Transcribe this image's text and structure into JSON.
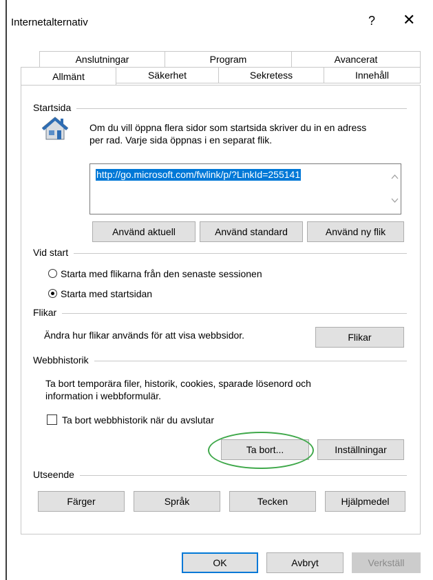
{
  "window": {
    "title": "Internetalternativ",
    "help_symbol": "?",
    "close_symbol": "✕"
  },
  "tabs_top": [
    "Anslutningar",
    "Program",
    "Avancerat"
  ],
  "tabs_bottom": [
    "Allmänt",
    "Säkerhet",
    "Sekretess",
    "Innehåll"
  ],
  "active_tab": "Allmänt",
  "startsida": {
    "title": "Startsida",
    "description_line1": "Om du vill öppna flera sidor som startsida skriver du in en adress",
    "description_line2": "per rad. Varje sida öppnas i en separat flik.",
    "url": "http://go.microsoft.com/fwlink/p/?LinkId=255141",
    "buttons": [
      "Använd aktuell",
      "Använd standard",
      "Använd ny flik"
    ]
  },
  "vid_start": {
    "title": "Vid start",
    "options": [
      "Starta med flikarna från den senaste sessionen",
      "Starta med startsidan"
    ],
    "selected_index": 1
  },
  "flikar": {
    "title": "Flikar",
    "description": "Ändra hur flikar används för att visa webbsidor.",
    "button": "Flikar"
  },
  "webbhistorik": {
    "title": "Webbhistorik",
    "description_line1": "Ta bort temporära filer, historik, cookies, sparade lösenord och",
    "description_line2": "information i webbformulär.",
    "checkbox_label": "Ta bort webbhistorik när du avslutar",
    "checkbox_checked": false,
    "delete_button": "Ta bort...",
    "settings_button": "Inställningar"
  },
  "utseende": {
    "title": "Utseende",
    "buttons": [
      "Färger",
      "Språk",
      "Tecken",
      "Hjälpmedel"
    ]
  },
  "footer": {
    "ok": "OK",
    "cancel": "Avbryt",
    "apply": "Verkställ"
  },
  "colors": {
    "highlight_ring": "#3fa84a",
    "selection": "#0078d7"
  }
}
